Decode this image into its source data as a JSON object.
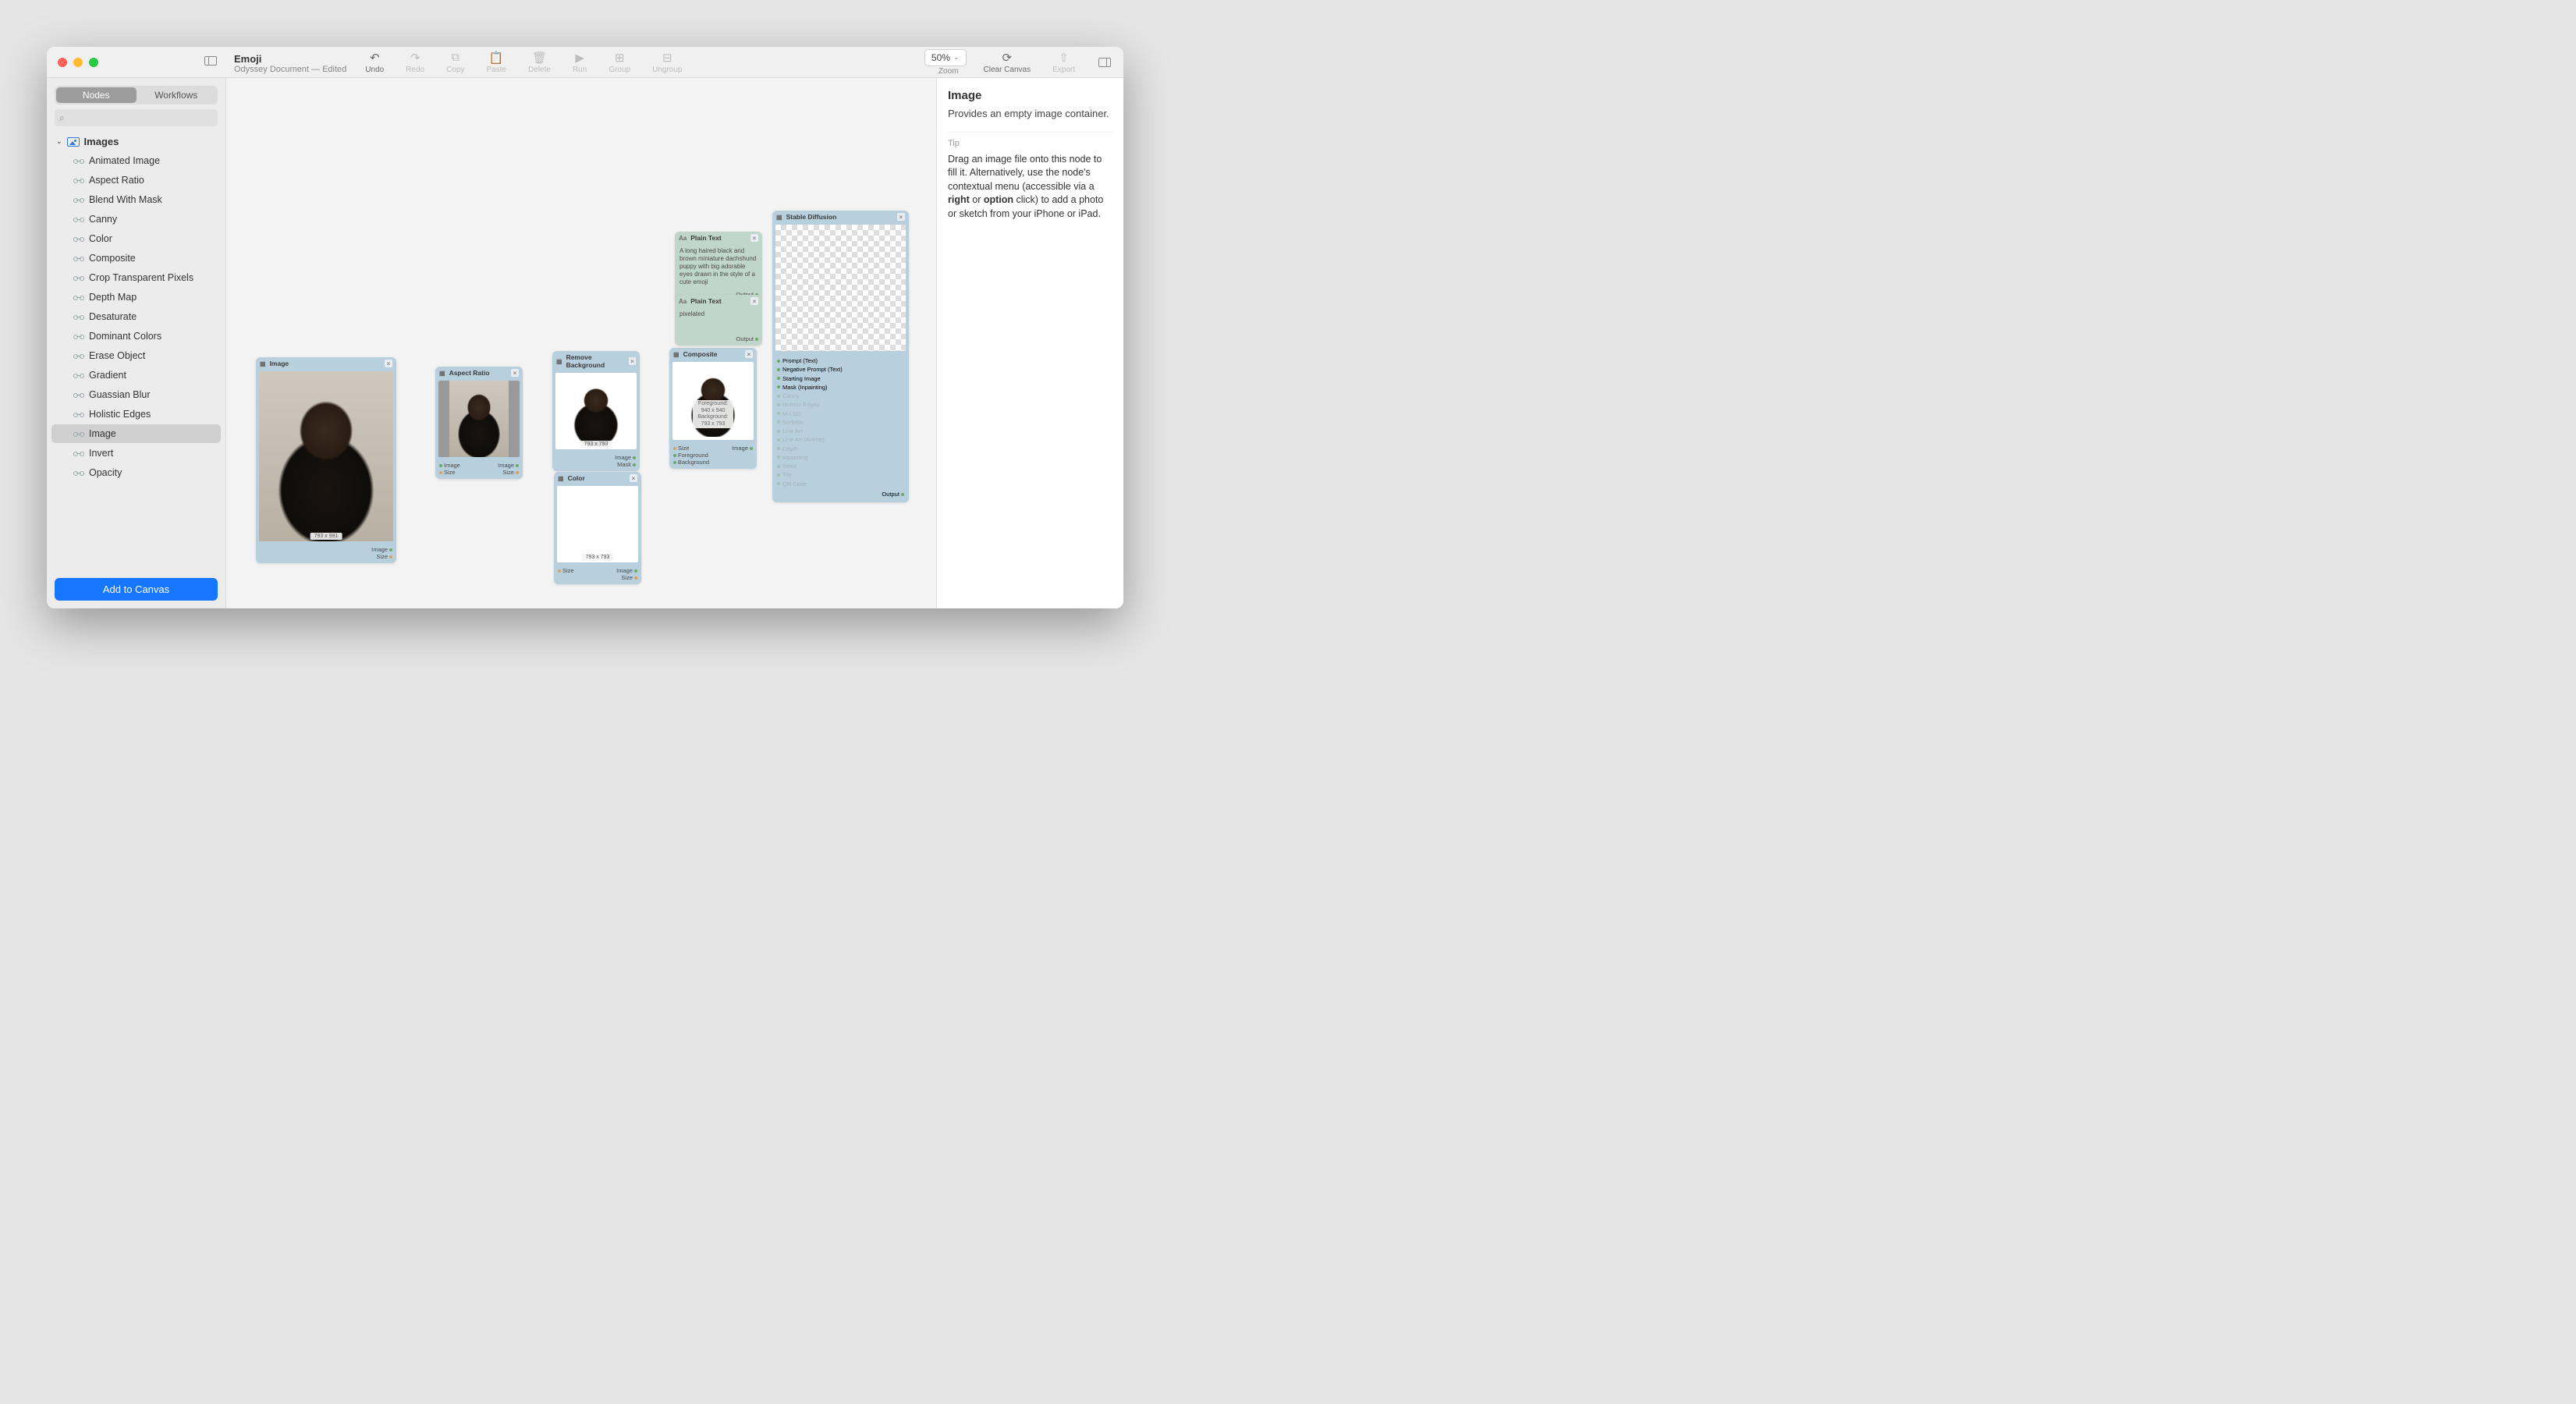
{
  "window": {
    "title": "Emoji",
    "subtitle": "Odyssey Document — Edited"
  },
  "toolbar": {
    "undo": "Undo",
    "redo": "Redo",
    "copy": "Copy",
    "paste": "Paste",
    "delete": "Delete",
    "run": "Run",
    "group": "Group",
    "ungroup": "Ungroup",
    "zoom_value": "50%",
    "zoom_label": "Zoom",
    "clear": "Clear Canvas",
    "export": "Export"
  },
  "sidebar": {
    "tabs": {
      "nodes": "Nodes",
      "workflows": "Workflows"
    },
    "section": "Images",
    "items": [
      "Animated Image",
      "Aspect Ratio",
      "Blend With Mask",
      "Canny",
      "Color",
      "Composite",
      "Crop Transparent Pixels",
      "Depth Map",
      "Desaturate",
      "Dominant Colors",
      "Erase Object",
      "Gradient",
      "Guassian Blur",
      "Holistic Edges",
      "Image",
      "Invert",
      "Opacity"
    ],
    "selected": "Image",
    "add_button": "Add to Canvas"
  },
  "canvas": {
    "nodes": {
      "image": {
        "title": "Image",
        "dims": "793 x 991",
        "out1": "Image",
        "out2": "Size"
      },
      "aspect": {
        "title": "Aspect Ratio",
        "in1": "Image",
        "in2": "Size",
        "out1": "Image",
        "out2": "Size"
      },
      "removebg": {
        "title": "Remove Background",
        "dims": "793 x 793",
        "out1": "Image",
        "out2": "Mask"
      },
      "composite": {
        "title": "Composite",
        "fg": "Foreground: 940 x 940",
        "bg": "Background: 793 x 793",
        "in1": "Size",
        "in2": "Foreground",
        "in3": "Background",
        "out1": "Image"
      },
      "color": {
        "title": "Color",
        "dims": "793 x 793",
        "in1": "Size",
        "out1": "Image",
        "out2": "Size"
      },
      "text1": {
        "title": "Plain Text",
        "body": "A long haired black and brown miniature dachshund puppy with big adorable eyes drawn in the style of a cute emoji",
        "out": "Output"
      },
      "text2": {
        "title": "Plain Text",
        "body": "pixelated",
        "out": "Output"
      },
      "sd": {
        "title": "Stable Diffusion",
        "ports": [
          "Prompt (Text)",
          "Negative Prompt (Text)",
          "Starting Image",
          "Mask (Inpainting)",
          "Canny",
          "Holistic Edges",
          "M-LSD",
          "Scribble",
          "Line Art",
          "Line Art (Anime)",
          "Depth",
          "Inpainting",
          "Seed",
          "Tile",
          "QR Code"
        ],
        "active_ports": [
          0,
          1,
          2,
          3
        ],
        "out": "Output"
      }
    }
  },
  "inspector": {
    "heading": "Image",
    "description": "Provides an empty image container.",
    "tip_label": "Tip",
    "tip_pre": "Drag an image file onto this node to fill it. Alternatively, use the node's contextual menu (accessible via a ",
    "tip_b1": "right",
    "tip_mid": " or ",
    "tip_b2": "option",
    "tip_post": " click) to add a photo or sketch from your iPhone or iPad."
  }
}
